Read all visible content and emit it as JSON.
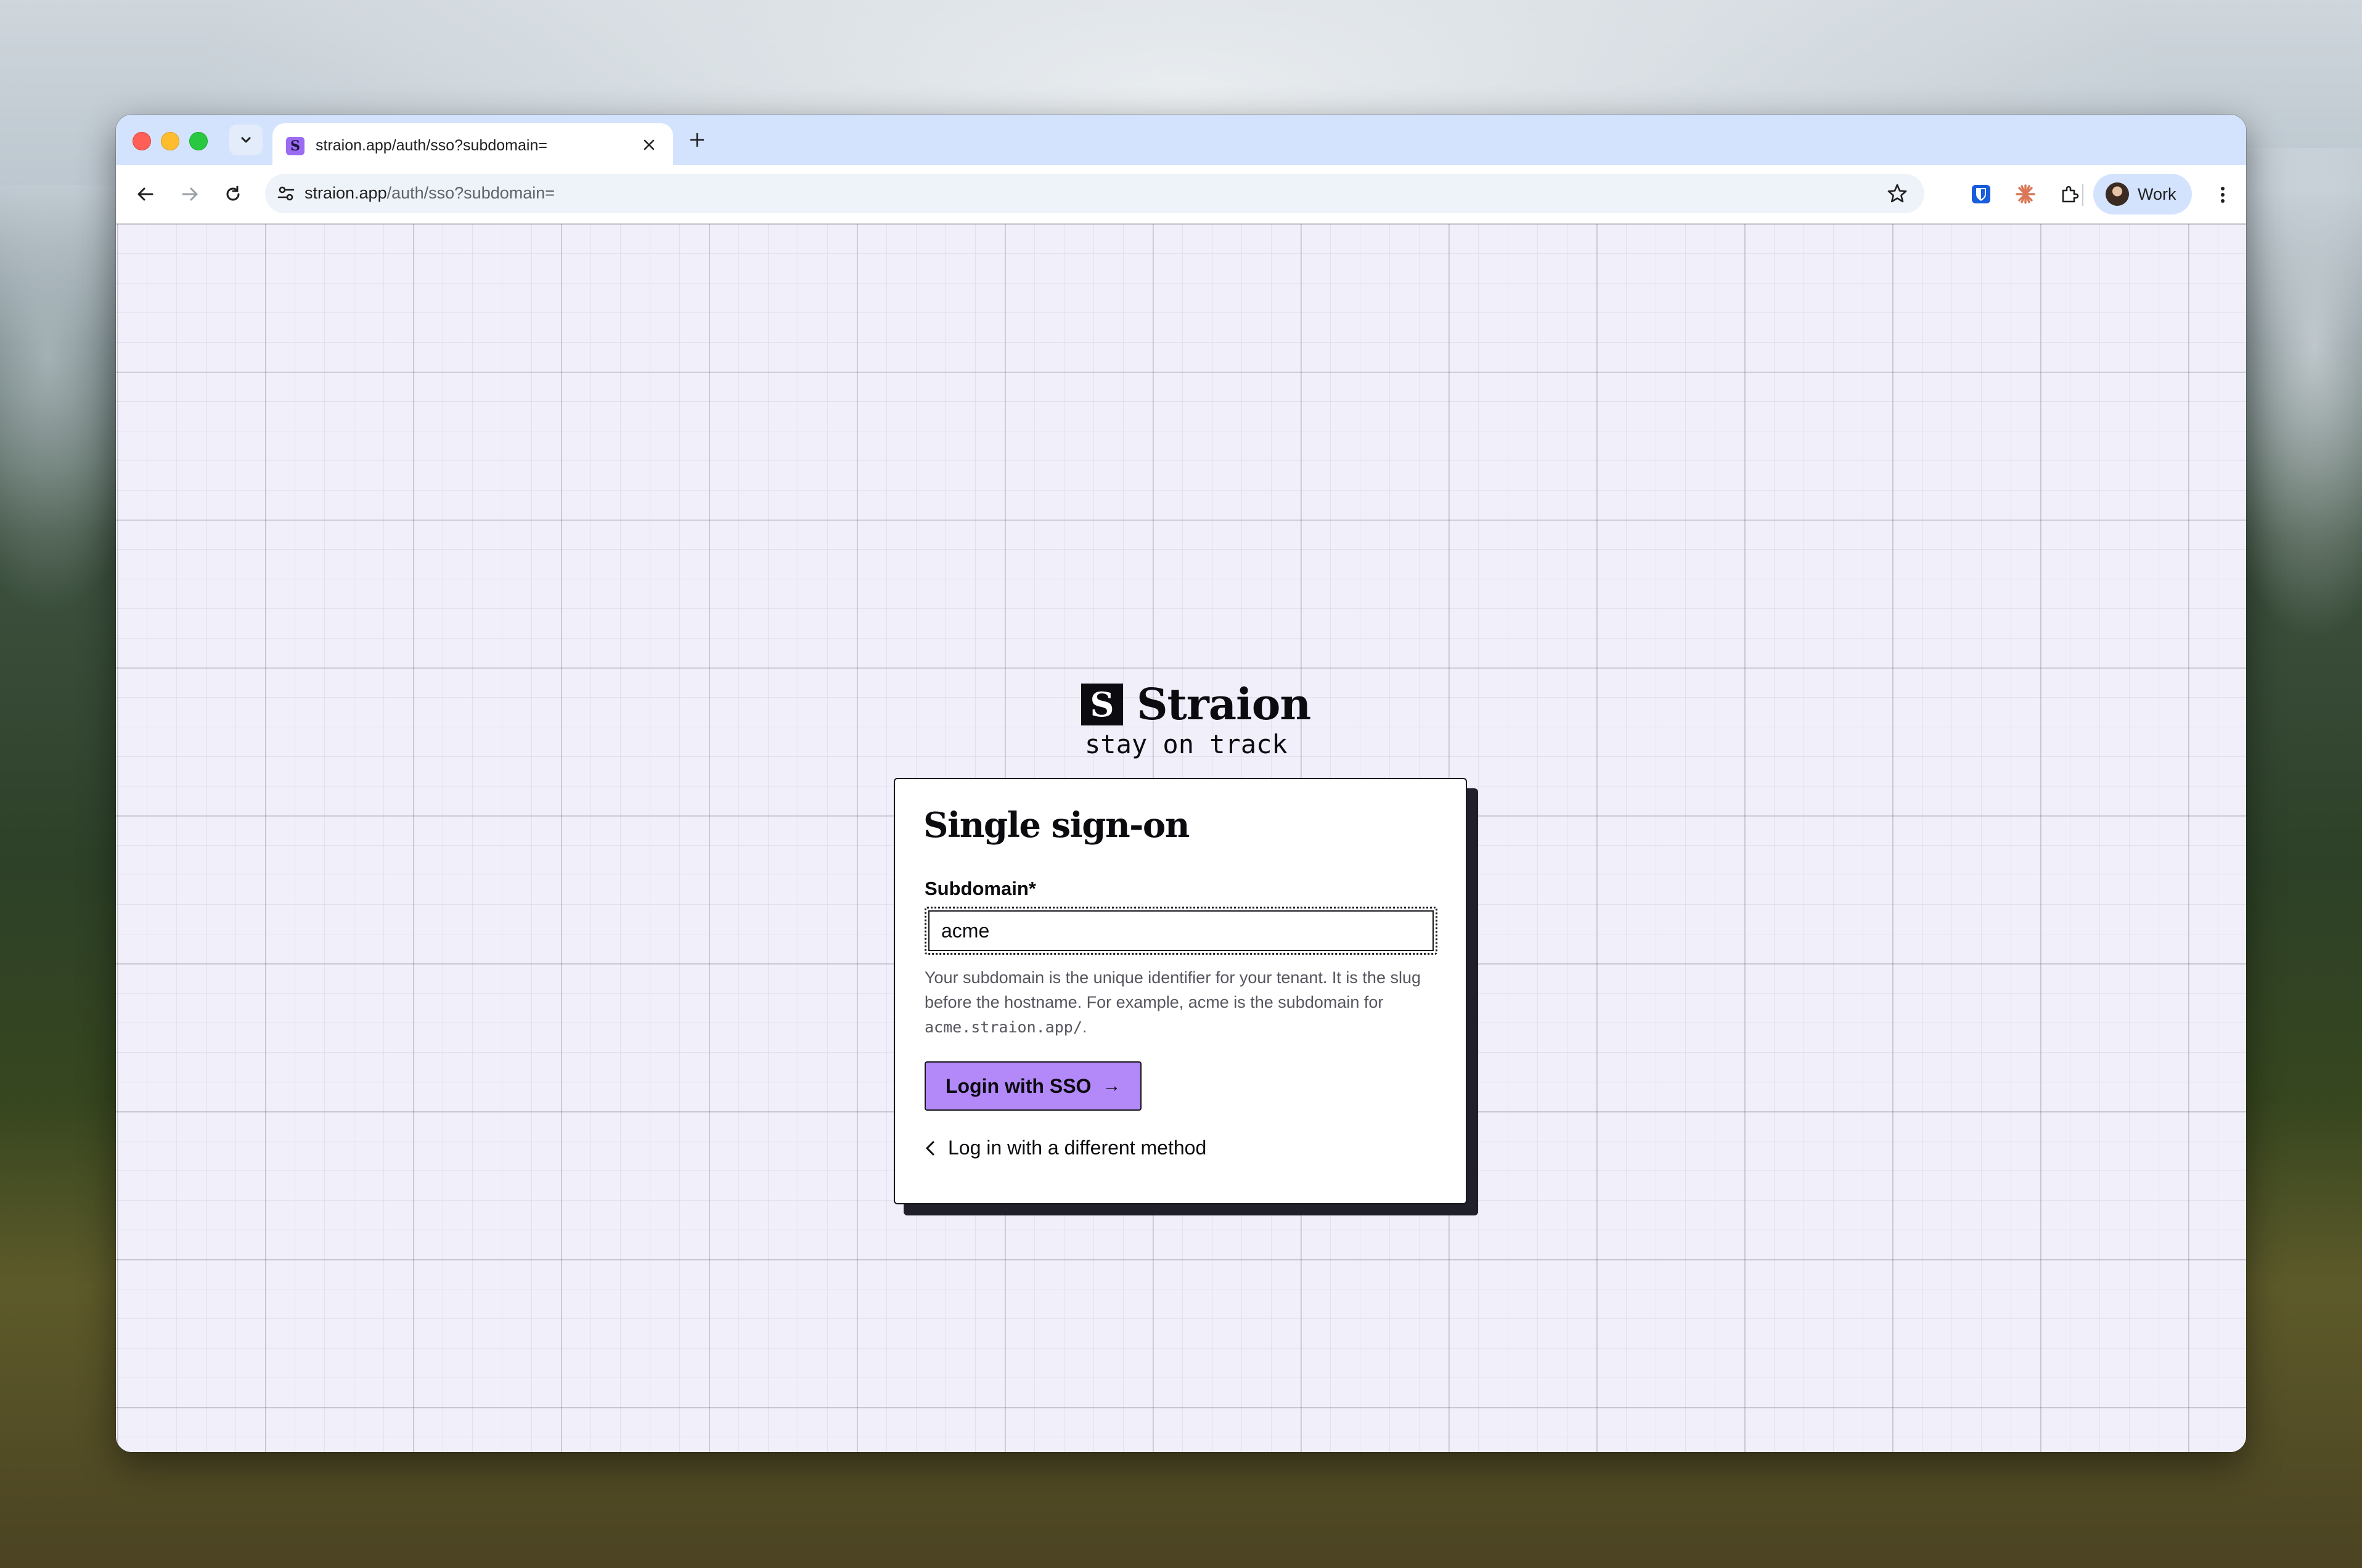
{
  "browser": {
    "tab": {
      "title": "straion.app/auth/sso?subdomain=",
      "favicon_letter": "S"
    },
    "address_bar": {
      "host": "straion.app",
      "path": "/auth/sso?subdomain="
    },
    "profile": {
      "label": "Work"
    },
    "icons": [
      "chevron-down-icon",
      "close-icon",
      "plus-icon",
      "back-arrow-icon",
      "forward-arrow-icon",
      "reload-icon",
      "site-settings-icon",
      "bookmark-star-icon",
      "bitwarden-icon",
      "claude-icon",
      "extensions-icon",
      "more-vertical-icon"
    ]
  },
  "app": {
    "brand": {
      "mark": "S",
      "name": "Straion",
      "tagline": "stay on track"
    },
    "card": {
      "title": "Single sign-on",
      "subdomain_label": "Subdomain*",
      "subdomain_value": "acme",
      "help_text": "Your subdomain is the unique identifier for your tenant. It is the slug before the hostname. For example, acme is the subdomain for ",
      "help_code": "acme.straion.app/",
      "help_end": ".",
      "submit_label": "Login with SSO",
      "submit_arrow": "→",
      "back_label": "Log in with a different method"
    }
  },
  "colors": {
    "accent": "#b388f8",
    "background": "#f1eff9",
    "ink": "#0b0b10",
    "tab_strip": "#d3e3fd"
  }
}
